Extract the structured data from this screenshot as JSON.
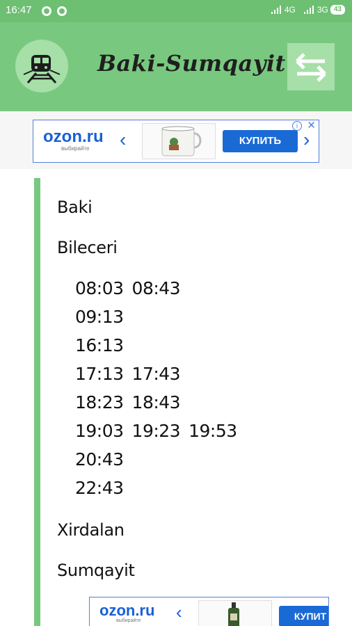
{
  "status_bar": {
    "time": "16:47",
    "network_1": "4G",
    "network_2": "3G",
    "battery": "43"
  },
  "app_bar": {
    "title": "Baki-Sumqayit",
    "logo_icon": "train-icon",
    "swap_icon": "swap-arrows-icon"
  },
  "ads": {
    "brand": "ozon.ru",
    "tagline": "выбирайте",
    "buy_label": "КУПИТЬ",
    "buy_label_partial": "КУПИТ"
  },
  "stations": [
    {
      "name": "Baki"
    },
    {
      "name": "Bileceri"
    },
    {
      "name": "Xirdalan"
    },
    {
      "name": "Sumqayit"
    }
  ],
  "schedule": [
    [
      "08:03",
      "08:43"
    ],
    [
      "09:13"
    ],
    [
      "16:13"
    ],
    [
      "17:13",
      "17:43"
    ],
    [
      "18:23",
      "18:43"
    ],
    [
      "19:03",
      "19:23",
      "19:53"
    ],
    [
      "20:43"
    ],
    [
      "22:43"
    ]
  ],
  "colors": {
    "status_bar": "#6dbf72",
    "app_bar": "#78c97f",
    "logo_bg": "#a6dfa8",
    "ad_blue": "#1a6ad6"
  }
}
